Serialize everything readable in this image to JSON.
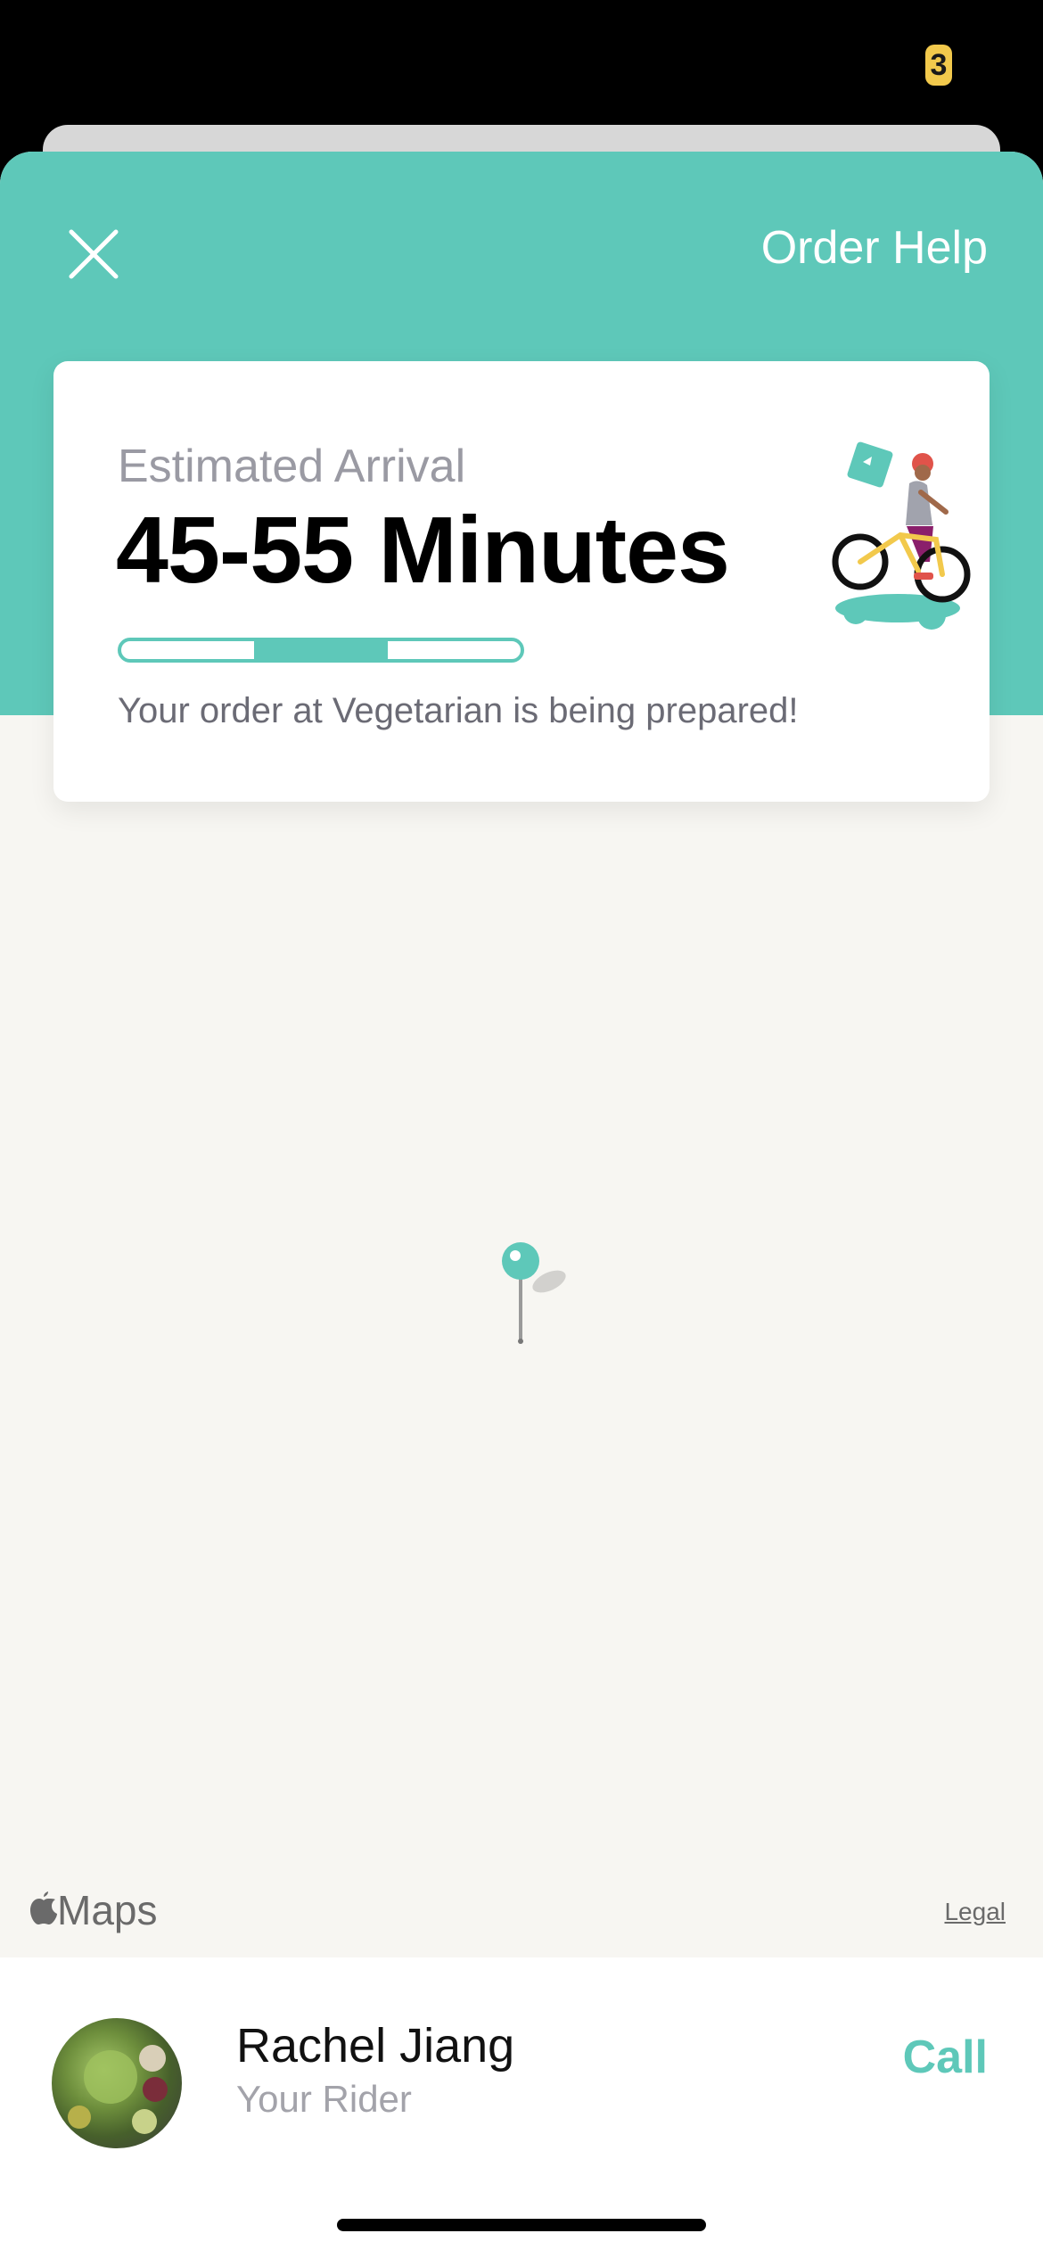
{
  "status_bar": {
    "badge": "3"
  },
  "header": {
    "order_help_label": "Order Help"
  },
  "eta_card": {
    "label": "Estimated Arrival",
    "value": "45-55 Minutes",
    "message": "Your order at Vegetarian is being prepared!",
    "progress": {
      "segments": 3,
      "active_segment": 1
    }
  },
  "map": {
    "provider_label": "Maps",
    "legal_label": "Legal"
  },
  "rider": {
    "name": "Rachel Jiang",
    "role": "Your Rider",
    "call_label": "Call"
  },
  "colors": {
    "accent": "#5ec8b9",
    "map_bg": "#f7f6f2",
    "muted_text": "#9a9aa3"
  },
  "icons": [
    "close-icon",
    "rider-illustration",
    "map-pin-icon",
    "apple-icon"
  ]
}
